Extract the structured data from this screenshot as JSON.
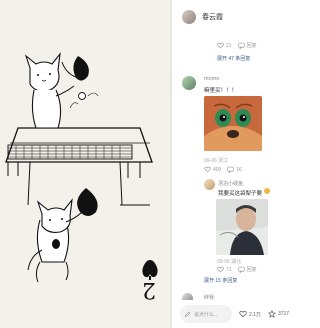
{
  "image": {
    "card_rank": "2",
    "card_suit": "spade-icon"
  },
  "comments": {
    "header_user": "春云霞",
    "first": {
      "likes": "21",
      "reply": "回复",
      "expand": "展开 47 条回复"
    },
    "second": {
      "user": "momo",
      "text": "嘛里买！！！",
      "meta": "09-06 浙江",
      "likes": "400",
      "replies": "16"
    },
    "reply": {
      "user": "漂泊小绒鱼",
      "text": "我要买这袋梨子要",
      "meta": "09-06 湖北",
      "likes": "71",
      "reply": "回复",
      "expand": "展开 15 条回复"
    },
    "fourth": {
      "user": "碎我"
    }
  },
  "bottom_bar": {
    "placeholder": "说点什么...",
    "likes": "2.1万",
    "collects": "3717"
  },
  "colors": {
    "link_blue": "#3c5a8a",
    "text_gray": "#999999",
    "card_bg": "#f4f1eb"
  }
}
